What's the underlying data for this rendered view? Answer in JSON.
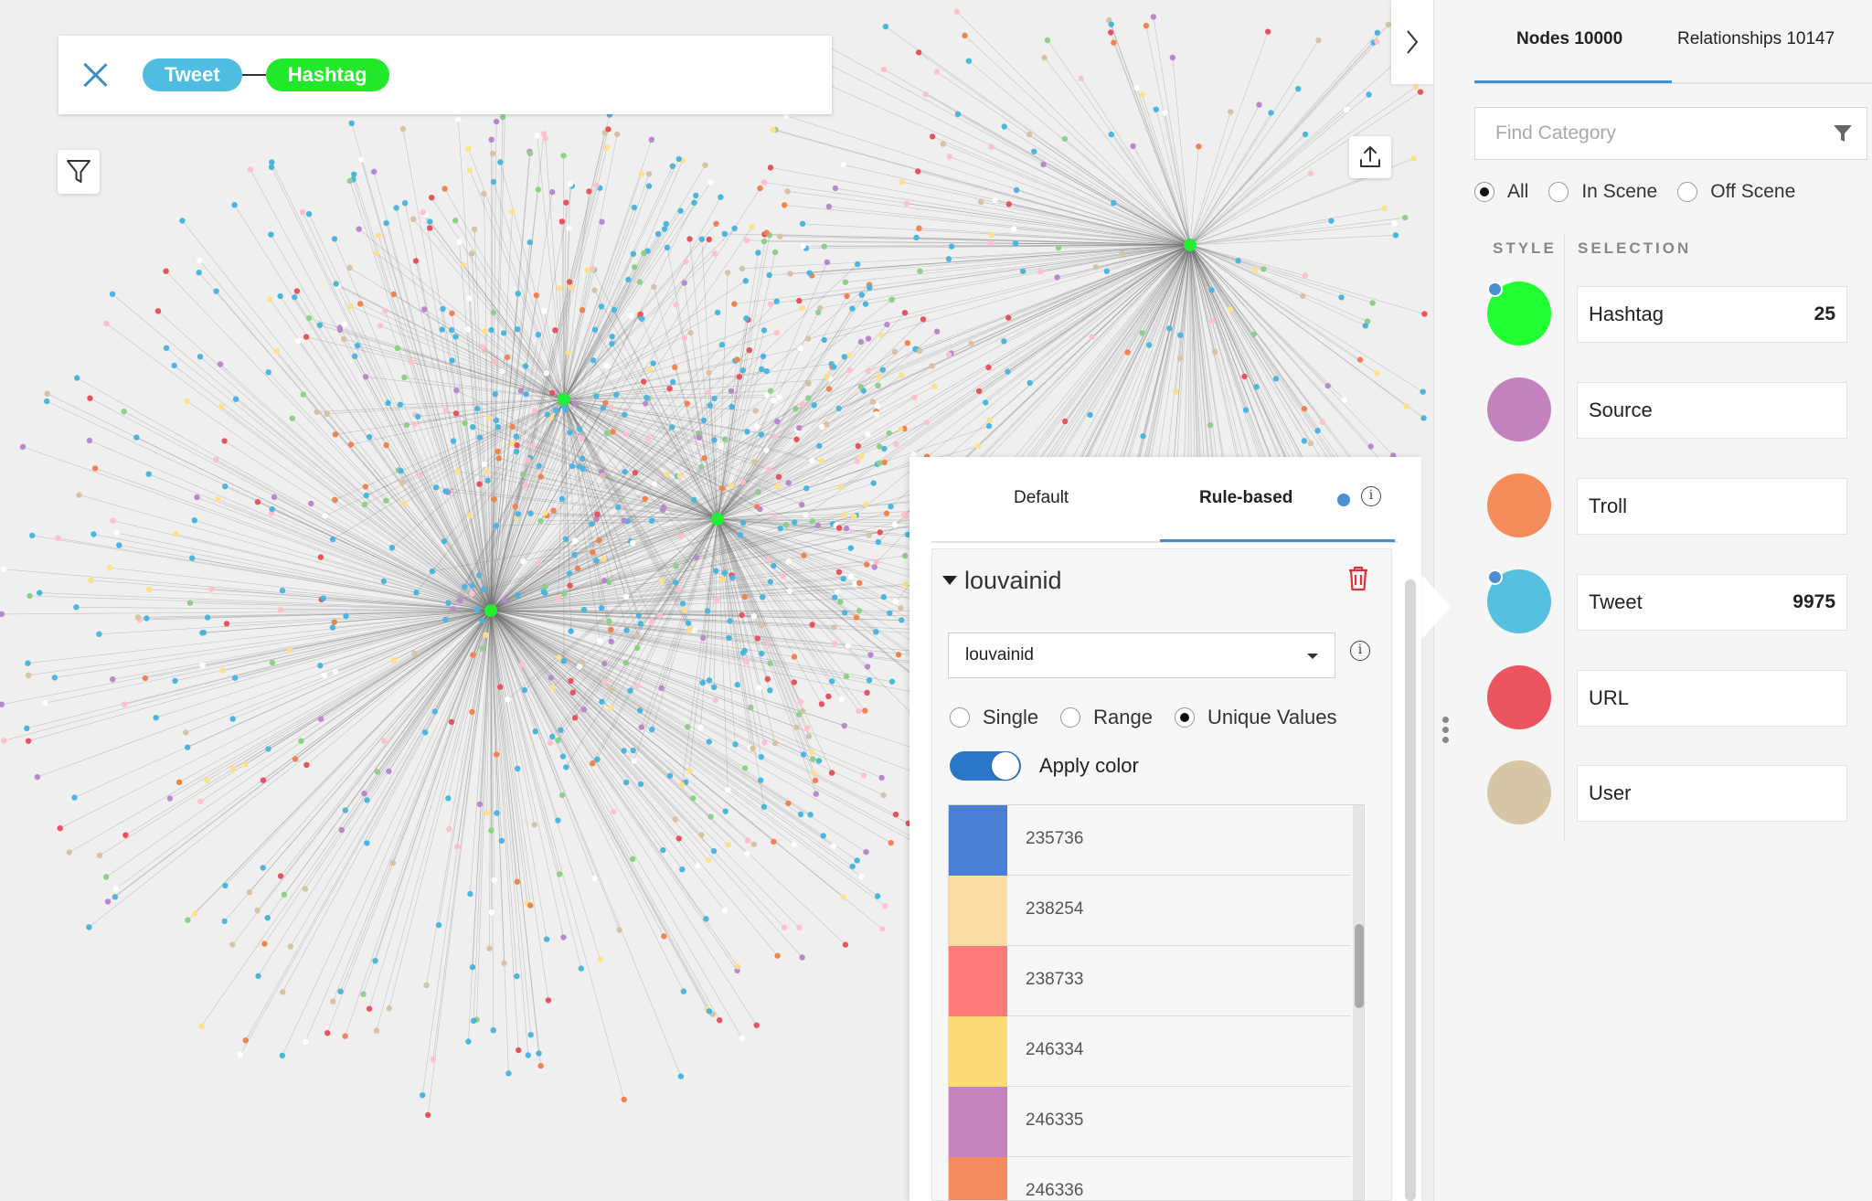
{
  "search": {
    "pill_tweet": "Tweet",
    "pill_hashtag": "Hashtag"
  },
  "panel": {
    "tab_nodes": "Nodes 10000",
    "tab_relationships": "Relationships 10147",
    "find_placeholder": "Find Category",
    "scope_options": [
      "All",
      "In Scene",
      "Off Scene"
    ],
    "scope_selected": "All",
    "style_header": "STYLE",
    "selection_header": "SELECTION",
    "categories": [
      {
        "name": "Hashtag",
        "count": "25",
        "color": "#22ff33",
        "marked": true
      },
      {
        "name": "Source",
        "count": "",
        "color": "#c382be",
        "marked": false
      },
      {
        "name": "Troll",
        "count": "",
        "color": "#f48c5c",
        "marked": false
      },
      {
        "name": "Tweet",
        "count": "9975",
        "color": "#55c0e0",
        "marked": true
      },
      {
        "name": "URL",
        "count": "",
        "color": "#ec5560",
        "marked": false
      },
      {
        "name": "User",
        "count": "",
        "color": "#d7c6a6",
        "marked": false
      }
    ]
  },
  "popover": {
    "tab_default": "Default",
    "tab_rule_based": "Rule-based",
    "rule_title": "louvainid",
    "property_value": "louvainid",
    "modes": [
      "Single",
      "Range",
      "Unique Values"
    ],
    "mode_selected": "Unique Values",
    "apply_color_label": "Apply color",
    "apply_color_on": true,
    "color_rules": [
      {
        "value": "235736",
        "color": "#4a7fd4"
      },
      {
        "value": "238254",
        "color": "#fddca4"
      },
      {
        "value": "238733",
        "color": "#fb7a7a"
      },
      {
        "value": "246334",
        "color": "#fddc78"
      },
      {
        "value": "246335",
        "color": "#c384be"
      },
      {
        "value": "246336",
        "color": "#f58c60"
      }
    ]
  },
  "graph": {
    "hub_color": "#22ee33",
    "edge_color": "#6c6c6c",
    "node_colors": [
      "#4db6df",
      "#4db6df",
      "#4db6df",
      "#4db6df",
      "#f08450",
      "#8fcf8a",
      "#d6c3a3",
      "#e8545c",
      "#bb88cc",
      "#ffe08a",
      "#ffc0cb",
      "#ffffff"
    ]
  },
  "colors": {
    "accent": "#4a90c8",
    "toggle": "#2b76c6",
    "danger": "#e0303a"
  }
}
